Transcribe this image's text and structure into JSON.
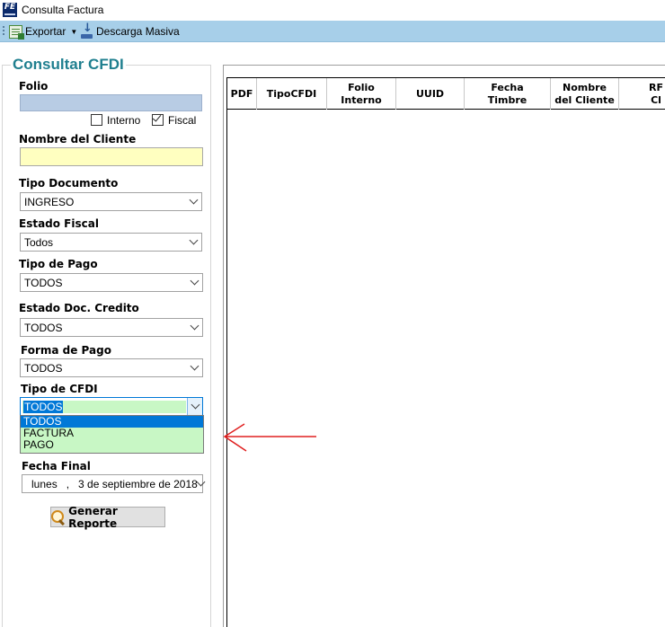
{
  "window": {
    "title": "Consulta Factura",
    "app_icon_text": "FE"
  },
  "toolbar": {
    "export_label": "Exportar",
    "descarga_label": "Descarga Masiva"
  },
  "panel": {
    "section_title": "Consultar CFDI",
    "folio": {
      "label": "Folio",
      "value": "",
      "interno_label": "Interno",
      "interno_checked": false,
      "fiscal_label": "Fiscal",
      "fiscal_checked": true
    },
    "cliente": {
      "label": "Nombre del Cliente",
      "value": ""
    },
    "tipo_documento": {
      "label": "Tipo Documento",
      "value": "INGRESO"
    },
    "estado_fiscal": {
      "label": "Estado Fiscal",
      "value": "Todos"
    },
    "tipo_pago": {
      "label": "Tipo de Pago",
      "value": "TODOS"
    },
    "estado_doc_credito": {
      "label": "Estado Doc. Credito",
      "value": "TODOS"
    },
    "forma_pago": {
      "label": "Forma de Pago",
      "value": "TODOS"
    },
    "tipo_cfdi": {
      "label": "Tipo de CFDI",
      "value": "TODOS",
      "options": [
        "TODOS",
        "FACTURA",
        "PAGO"
      ]
    },
    "fecha_final": {
      "label": "Fecha Final",
      "value": "lunes   ,   3 de septiembre de 2018"
    },
    "generate_label": "Generar Reporte"
  },
  "grid": {
    "columns": [
      "PDF",
      "TipoCFDI",
      "Folio\nInterno",
      "UUID",
      "Fecha\nTimbre",
      "Nombre\ndel Cliente",
      "RF\nCl"
    ]
  },
  "colors": {
    "toolbar": "#a7cfe9",
    "section_title": "#1f7f8f",
    "folio_bg": "#b8cce4",
    "cliente_bg": "#ffffc0",
    "combo_highlight": "#c8f7c5",
    "selection": "#0078d7",
    "annotation_arrow": "#e02020"
  }
}
